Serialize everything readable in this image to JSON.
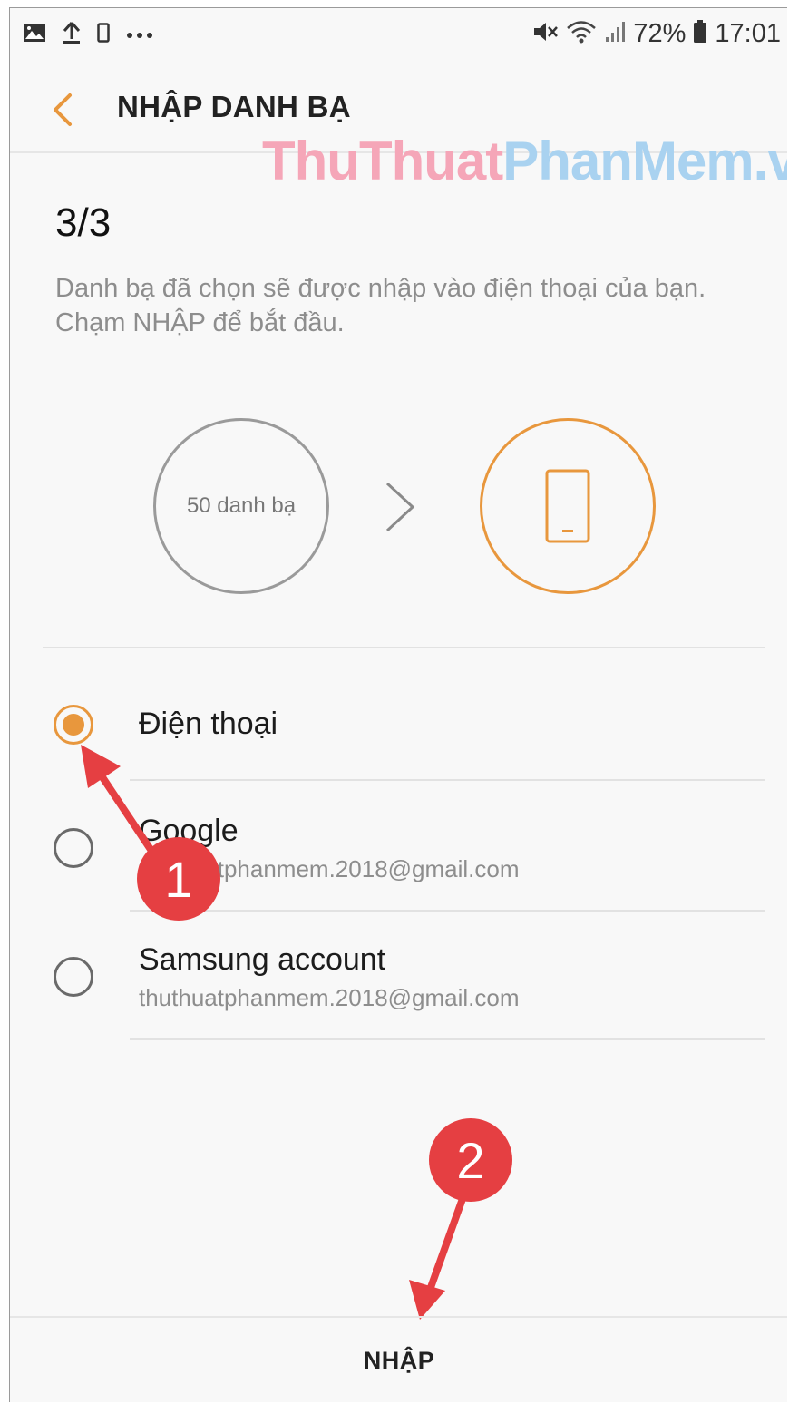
{
  "status_bar": {
    "left_icons": [
      "image-icon",
      "upload-icon",
      "phone-outline-icon",
      "more-dots-icon"
    ],
    "right_icons": [
      "mute-vibrate-icon",
      "wifi-icon",
      "signal-icon",
      "battery-icon"
    ],
    "battery": "72%",
    "time": "17:01"
  },
  "header": {
    "back_icon": "chevron-left-icon",
    "title": "NHẬP DANH BẠ"
  },
  "watermark": {
    "part1": "ThuThuat",
    "part2": "PhanMem.vn"
  },
  "content": {
    "step": "3/3",
    "description": "Danh bạ đã chọn sẽ được nhập vào điện thoại của bạn. Chạm NHẬP để bắt đầu.",
    "source_label": "50 danh bạ",
    "destination_icon": "phone-icon"
  },
  "options": [
    {
      "label": "Điện thoại",
      "sub": "",
      "selected": true
    },
    {
      "label": "Google",
      "sub": "thuthuatphanmem.2018@gmail.com",
      "selected": false
    },
    {
      "label": "Samsung account",
      "sub": "thuthuatphanmem.2018@gmail.com",
      "selected": false
    }
  ],
  "annotations": {
    "badge1": "1",
    "badge2": "2"
  },
  "footer": {
    "import_label": "NHẬP"
  },
  "colors": {
    "accent": "#e8973d",
    "annotation_red": "#e53f42",
    "watermark_pink": "#f5a6b8",
    "watermark_blue": "#a9d2f0"
  }
}
